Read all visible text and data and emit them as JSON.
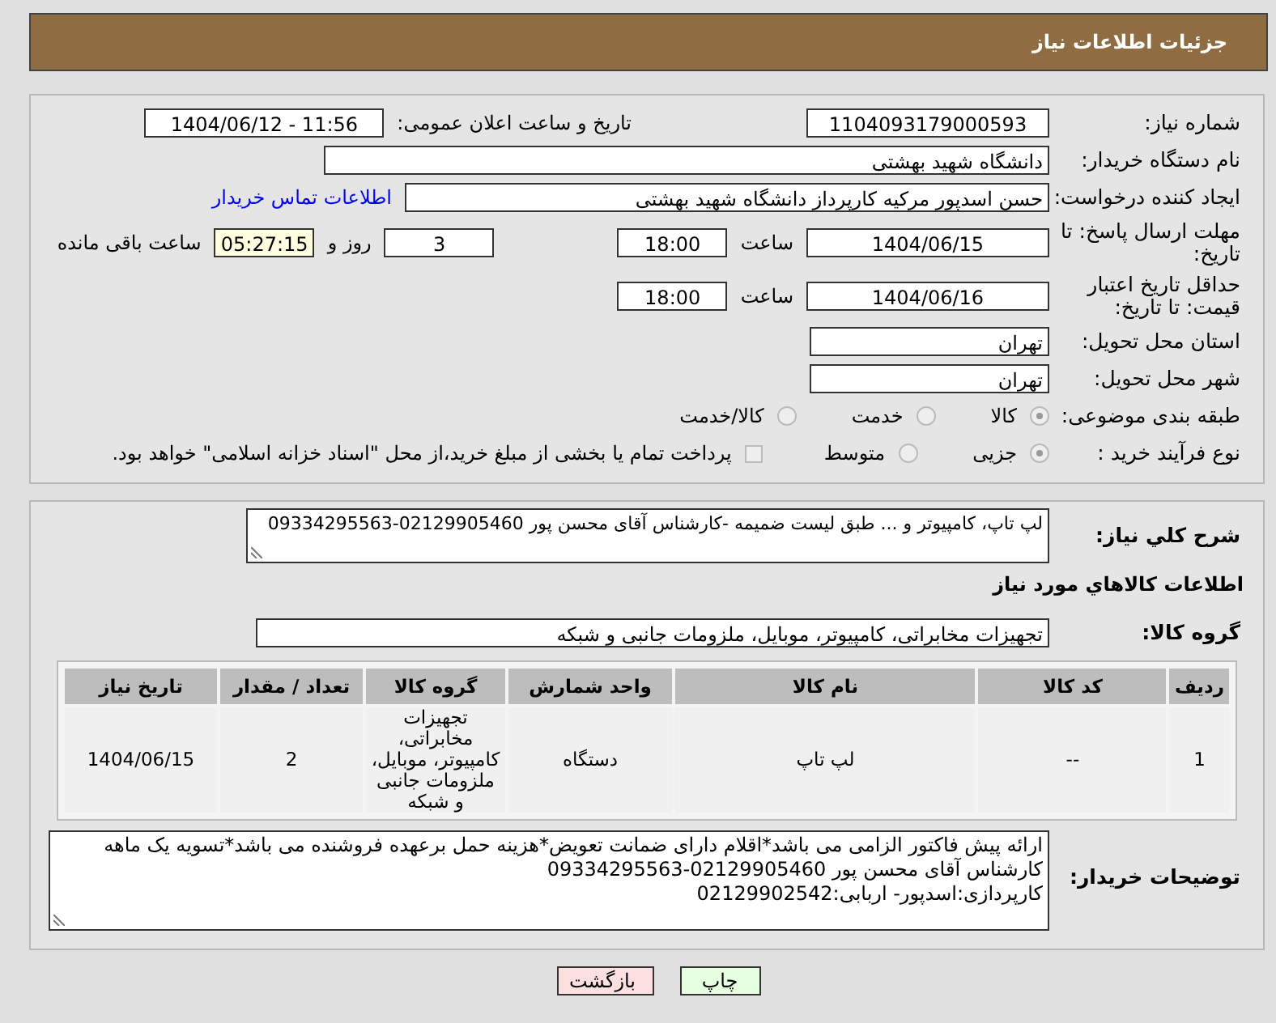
{
  "title": "جزئیات اطلاعات نیاز",
  "need_number": {
    "label": "شماره نیاز:",
    "value": "1104093179000593"
  },
  "announce": {
    "label": "تاریخ و ساعت اعلان عمومی:",
    "value": "1404/06/12 - 11:56"
  },
  "buyer_org": {
    "label": "نام دستگاه خریدار:",
    "value": "دانشگاه شهید بهشتی"
  },
  "requester": {
    "label": "ایجاد کننده درخواست:",
    "value": "حسن اسدپور مرکیه کارپرداز دانشگاه شهید بهشتی",
    "link": "اطلاعات تماس خریدار"
  },
  "reply_deadline": {
    "label": "مهلت ارسال پاسخ: تا تاریخ:",
    "date": "1404/06/15",
    "time_label": "ساعت",
    "time": "18:00",
    "days": "3",
    "days_label": "روز و",
    "remaining": "05:27:15",
    "remaining_label": "ساعت باقی مانده"
  },
  "price_validity": {
    "label": "حداقل تاریخ اعتبار قیمت: تا تاریخ:",
    "date": "1404/06/16",
    "time_label": "ساعت",
    "time": "18:00"
  },
  "province": {
    "label": "استان محل تحویل:",
    "value": "تهران"
  },
  "city": {
    "label": "شهر محل تحویل:",
    "value": "تهران"
  },
  "category": {
    "label": "طبقه بندی موضوعی:",
    "options": [
      {
        "label": "کالا",
        "selected": true
      },
      {
        "label": "خدمت",
        "selected": false
      },
      {
        "label": "کالا/خدمت",
        "selected": false
      }
    ]
  },
  "process": {
    "label": "نوع فرآیند خرید :",
    "options": [
      {
        "label": "جزیی",
        "selected": true
      },
      {
        "label": "متوسط",
        "selected": false
      }
    ],
    "payment": {
      "label": "پرداخت تمام یا بخشی از مبلغ خرید،از محل \"اسناد خزانه اسلامی\" خواهد بود.",
      "checked": false
    }
  },
  "description": {
    "label": "شرح کلي نياز:",
    "value": "لپ تاپ، کامپیوتر و ... طبق لیست ضمیمه -کارشناس آقای محسن پور 02129905460-09334295563"
  },
  "goods_heading": "اطلاعات كالاهاي مورد نياز",
  "goods_group": {
    "label": "گروه کالا:",
    "value": "تجهیزات مخابراتی، کامپیوتر، موبایل، ملزومات جانبی و شبکه"
  },
  "table": {
    "columns": [
      "ردیف",
      "کد کالا",
      "نام کالا",
      "واحد شمارش",
      "گروه کالا",
      "تعداد / مقدار",
      "تاریخ نیاز"
    ],
    "rows": [
      [
        "1",
        "--",
        "لپ تاپ",
        "دستگاه",
        "تجهیزات مخابراتی، کامپیوتر، موبایل، ملزومات جانبی و شبکه",
        "2",
        "1404/06/15"
      ]
    ]
  },
  "buyer_notes": {
    "label": "توضیحات خریدار:",
    "lines": [
      "ارائه پیش فاکتور الزامی می باشد*اقلام دارای ضمانت تعویض*هزینه حمل برعهده فروشنده می باشد*تسویه یک ماهه",
      "کارشناس آقای محسن پور 02129905460-09334295563",
      "کارپردازی:اسدپور- اربابی:02129902542"
    ]
  },
  "buttons": [
    {
      "label": "چاپ",
      "kind": "print"
    },
    {
      "label": "بازگشت",
      "kind": "back"
    }
  ]
}
